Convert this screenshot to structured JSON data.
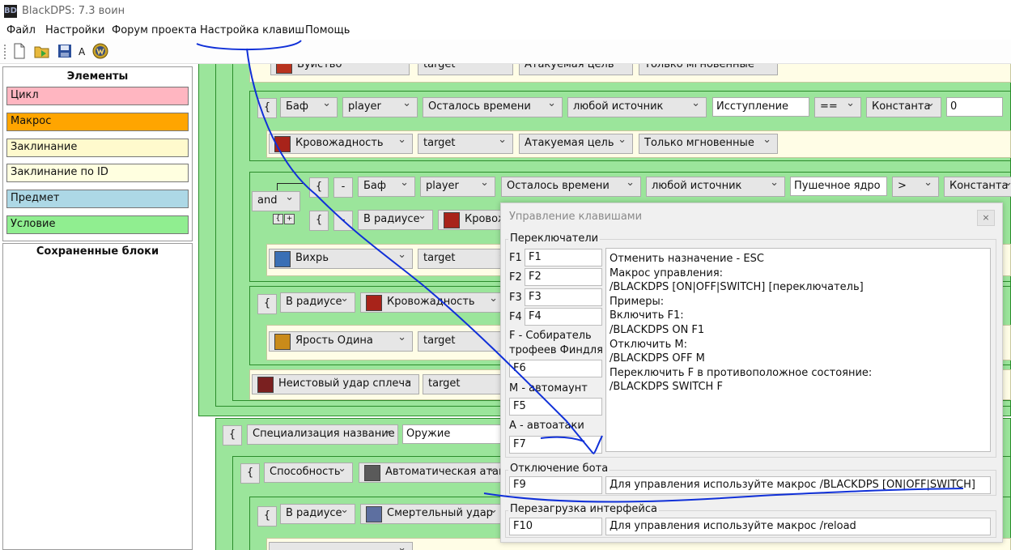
{
  "window": {
    "title": "BlackDPS: 7.3 воин",
    "app_icon": "BD"
  },
  "menu": [
    "Файл",
    "Настройки",
    "Форум проекта",
    "Настройка клавиш",
    "Помощь"
  ],
  "toolbar": {
    "letter": "A"
  },
  "elements_panel": {
    "title": "Элементы",
    "items": [
      {
        "label": "Цикл",
        "color": "#ffb6c1"
      },
      {
        "label": "Макрос",
        "color": "#ffa500"
      },
      {
        "label": "Заклинание",
        "color": "#fffacd"
      },
      {
        "label": "Заклинание по ID",
        "color": "#ffffe0"
      },
      {
        "label": "Предмет",
        "color": "#add8e6"
      },
      {
        "label": "Условие",
        "color": "#90ee90"
      }
    ]
  },
  "saved_panel": {
    "title": "Сохраненные блоки"
  },
  "blocks": {
    "r0": {
      "spell": "Буйство",
      "unit": "target",
      "target_type": "Атакуемая цель",
      "cast": "Только мгновенные"
    },
    "r1": {
      "brace": "{",
      "kind": "Баф",
      "unit": "player",
      "param": "Осталось времени",
      "source": "любой источник",
      "name": "Исступление",
      "op": "==",
      "cmp": "Константа",
      "value": "0"
    },
    "r2": {
      "spell": "Кровожадность",
      "unit": "target",
      "target_type": "Атакуемая цель",
      "cast": "Только мгновенные"
    },
    "r3": {
      "logic": "and",
      "brace": "{",
      "minus": "-",
      "kind": "Баф",
      "unit": "player",
      "param": "Осталось времени",
      "source": "любой источник",
      "name": "Пушечное ядро",
      "op": ">",
      "cmp": "Константа",
      "mini_a": "{",
      "mini_b": "+"
    },
    "r4": {
      "brace": "{",
      "minus": "-",
      "kind": "В радиусе",
      "spell": "Кровож"
    },
    "r5": {
      "spell": "Вихрь",
      "unit": "target"
    },
    "r6": {
      "brace": "{",
      "kind": "В радиусе",
      "spell": "Кровожадность"
    },
    "r7": {
      "spell": "Ярость Одина",
      "unit": "target"
    },
    "r8": {
      "spell": "Неистовый удар сплеча",
      "unit": "target"
    },
    "r9": {
      "brace": "{",
      "kind": "Специализация название",
      "name": "Оружие"
    },
    "r10": {
      "brace": "{",
      "kind": "Способность",
      "spell": "Автоматическая атака"
    },
    "r11": {
      "brace": "{",
      "kind": "В радиусе",
      "spell": "Смертельный удар"
    }
  },
  "dialog": {
    "title": "Управление клавишами",
    "close": "×",
    "switches": {
      "label": "Переключатели",
      "keys": [
        {
          "label": "F1",
          "value": "F1"
        },
        {
          "label": "F2",
          "value": "F2"
        },
        {
          "label": "F3",
          "value": "F3"
        },
        {
          "label": "F4",
          "value": "F4"
        }
      ],
      "named": [
        {
          "label": "F - Собиратель",
          "label2": "трофеев Финдля",
          "value": "F6"
        },
        {
          "label": "M - автомаунт",
          "value": "F5"
        },
        {
          "label": "A - автоатаки",
          "value": "F7"
        }
      ],
      "instructions": [
        "Отменить назначение - ESC",
        "Макрос управления:",
        "/BLACKDPS [ON|OFF|SWITCH] [переключатель]",
        "Примеры:",
        "Включить F1:",
        "/BLACKDPS ON F1",
        "Отключить M:",
        "/BLACKDPS OFF M",
        "Переключить F в противоположное состояние:",
        "/BLACKDPS SWITCH F"
      ]
    },
    "bot_off": {
      "label": "Отключение бота",
      "key": "F9",
      "hint": "Для управления используйте макрос /BLACKDPS [ON|OFF|SWITCH]"
    },
    "reload": {
      "label": "Перезагрузка интерфейса",
      "key": "F10",
      "hint": "Для управления используйте макрос /reload"
    }
  }
}
